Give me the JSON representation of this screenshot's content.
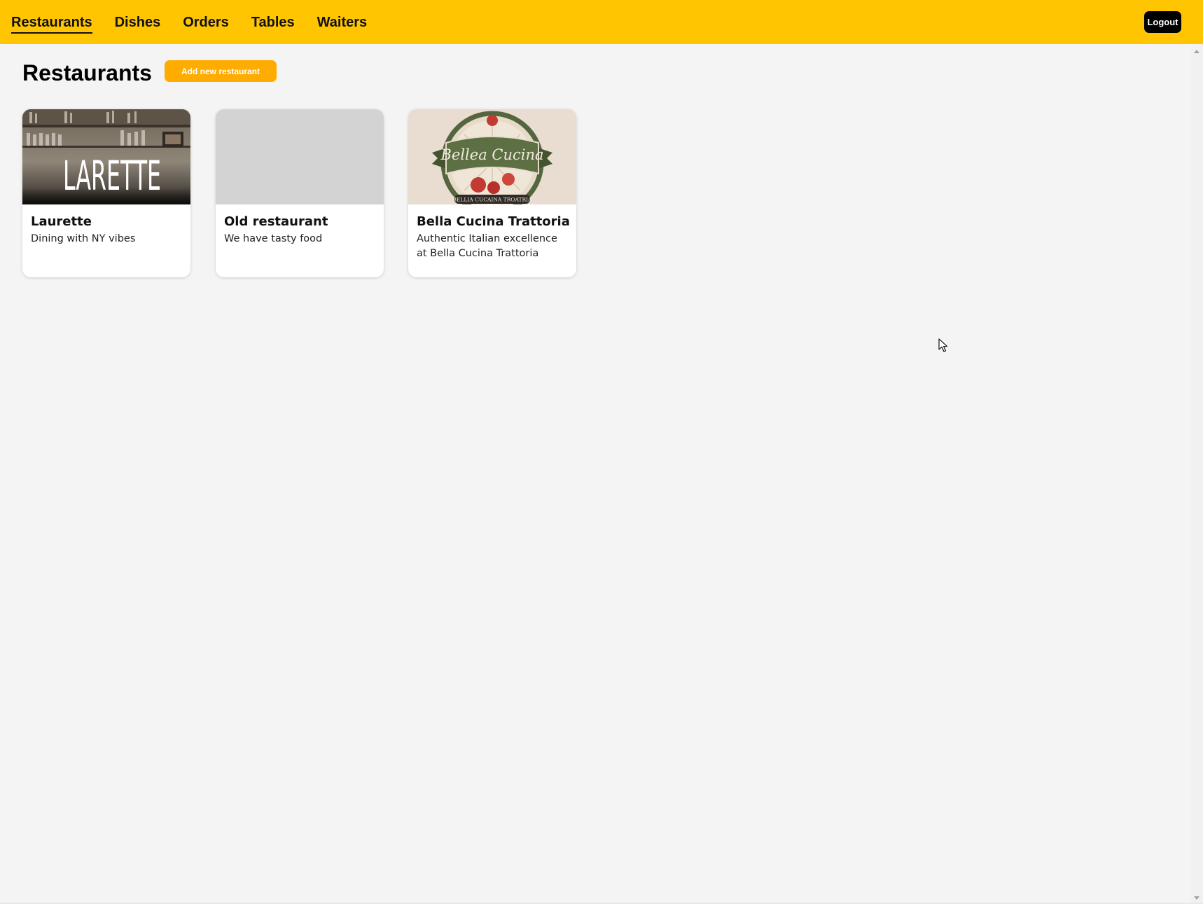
{
  "nav": {
    "items": [
      {
        "label": "Restaurants",
        "active": true
      },
      {
        "label": "Dishes",
        "active": false
      },
      {
        "label": "Orders",
        "active": false
      },
      {
        "label": "Tables",
        "active": false
      },
      {
        "label": "Waiters",
        "active": false
      }
    ],
    "logout_label": "Logout"
  },
  "main": {
    "title": "Restaurants",
    "add_button_label": "Add new restaurant",
    "restaurants": [
      {
        "name": "Laurette",
        "description": "Dining with NY vibes",
        "image": "restaurant-photo"
      },
      {
        "name": "Old restaurant",
        "description": "We have tasty food",
        "image": "placeholder"
      },
      {
        "name": "Bella Cucina Trattoria",
        "description": "Authentic Italian excellence at Bella Cucina Trattoria",
        "image": "restaurant-logo"
      }
    ]
  },
  "images": {
    "laurette_sign": "LARETTE",
    "bella_logo_script": "Bellea Cucina",
    "bella_logo_banner": "BELLIA CUCAINA TROATRIA"
  },
  "colors": {
    "topbar": "#ffc500",
    "add_button": "#ffac00",
    "logout_button": "#000000",
    "background": "#f4f4f4"
  }
}
